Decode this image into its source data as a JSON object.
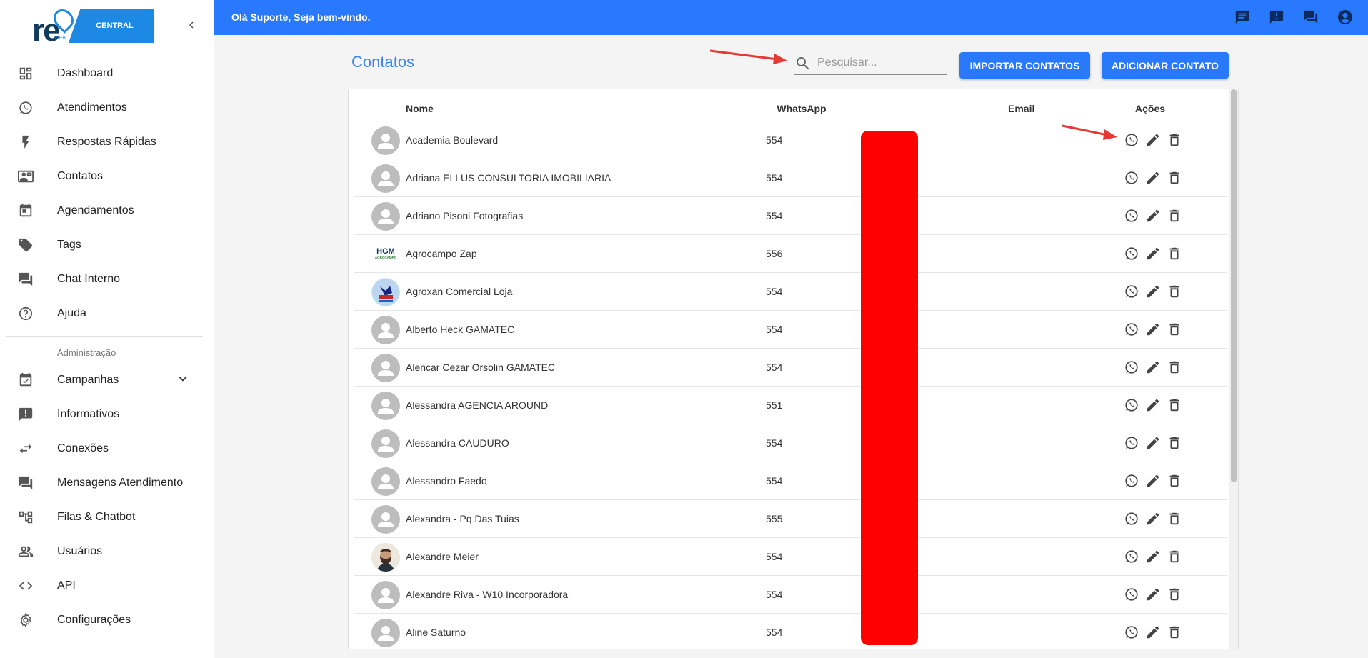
{
  "sidebar": {
    "brand_text": "CENTRAL",
    "logo_text": "re",
    "logo_sub": "WEB",
    "items": [
      {
        "label": "Dashboard",
        "icon": "dashboard-icon"
      },
      {
        "label": "Atendimentos",
        "icon": "whatsapp-icon"
      },
      {
        "label": "Respostas Rápidas",
        "icon": "bolt-icon"
      },
      {
        "label": "Contatos",
        "icon": "contact-card-icon"
      },
      {
        "label": "Agendamentos",
        "icon": "calendar-icon"
      },
      {
        "label": "Tags",
        "icon": "tag-icon"
      },
      {
        "label": "Chat Interno",
        "icon": "forum-icon"
      },
      {
        "label": "Ajuda",
        "icon": "help-icon"
      }
    ],
    "section_label": "Administração",
    "admin_items": [
      {
        "label": "Campanhas",
        "icon": "event-check-icon"
      },
      {
        "label": "Informativos",
        "icon": "announcement-icon"
      },
      {
        "label": "Conexões",
        "icon": "swap-icon"
      },
      {
        "label": "Mensagens Atendimento",
        "icon": "forum-icon"
      },
      {
        "label": "Filas & Chatbot",
        "icon": "account-tree-icon"
      },
      {
        "label": "Usuários",
        "icon": "people-icon"
      },
      {
        "label": "API",
        "icon": "code-icon"
      },
      {
        "label": "Configurações",
        "icon": "settings-icon"
      }
    ]
  },
  "topbar": {
    "welcome": "Olá Suporte, Seja bem-vindo."
  },
  "page": {
    "title": "Contatos",
    "search_placeholder": "Pesquisar...",
    "import_label": "IMPORTAR CONTATOS",
    "add_label": "ADICIONAR CONTATO"
  },
  "table": {
    "headers": {
      "name": "Nome",
      "whatsapp": "WhatsApp",
      "email": "Email",
      "actions": "Ações"
    },
    "rows": [
      {
        "name": "Academia Boulevard",
        "whatsapp": "554",
        "avatar": "default"
      },
      {
        "name": "Adriana ELLUS CONSULTORIA IMOBILIARIA",
        "whatsapp": "554",
        "avatar": "default"
      },
      {
        "name": "Adriano Pisoni Fotografias",
        "whatsapp": "554",
        "avatar": "default"
      },
      {
        "name": "Agrocampo Zap",
        "whatsapp": "556",
        "avatar": "hgm"
      },
      {
        "name": "Agroxan Comercial Loja",
        "whatsapp": "554",
        "avatar": "agroxan"
      },
      {
        "name": "Alberto Heck GAMATEC",
        "whatsapp": "554",
        "avatar": "default"
      },
      {
        "name": "Alencar Cezar Orsolin GAMATEC",
        "whatsapp": "554",
        "avatar": "default"
      },
      {
        "name": "Alessandra AGENCIA AROUND",
        "whatsapp": "551",
        "avatar": "default"
      },
      {
        "name": "Alessandra CAUDURO",
        "whatsapp": "554",
        "avatar": "default"
      },
      {
        "name": "Alessandro Faedo",
        "whatsapp": "554",
        "avatar": "default"
      },
      {
        "name": "Alexandra - Pq Das Tuias",
        "whatsapp": "555",
        "avatar": "default"
      },
      {
        "name": "Alexandre Meier",
        "whatsapp": "554",
        "avatar": "photo"
      },
      {
        "name": "Alexandre Riva - W10 Incorporadora",
        "whatsapp": "554",
        "avatar": "default"
      },
      {
        "name": "Aline Saturno",
        "whatsapp": "554",
        "avatar": "default"
      }
    ]
  },
  "colors": {
    "primary": "#2979ff",
    "title": "#3d85f0",
    "redaction": "#ff0000",
    "arrow": "#e53935"
  },
  "avatar_text": {
    "hgm": "HGM",
    "hgm_sub": "AGROCAMPO"
  }
}
